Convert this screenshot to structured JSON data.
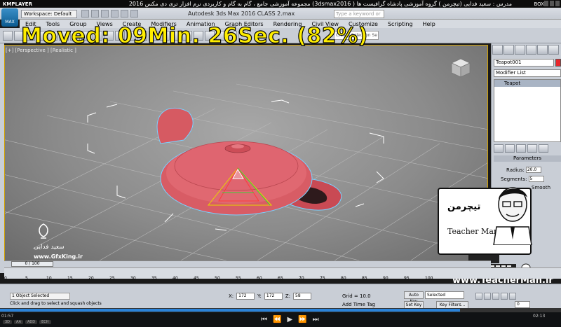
{
  "player": {
    "logo": "KMPLAYER",
    "title": "مجموعه آموزشی جامع ، گام به گام و کاربردی نرم افزار تری دی مکس 2016 (3dsmax2016 ) مدرس : سعید فدایی (تیچرمن ) گروه آموزشی پادشاه گرافیست ها",
    "box_label": "BOX",
    "time_current": "01:57",
    "time_total": "02:13",
    "progress_fraction": 0.82,
    "controls": [
      "⏮",
      "⏪",
      "▶",
      "⏩",
      "⏭"
    ],
    "badges": [
      "3D",
      "AA",
      "ADD",
      "ECH"
    ]
  },
  "overlay": {
    "moved_text": "Moved: 09Min. 26Sec. (82%)"
  },
  "max": {
    "app_button": "MAX",
    "workspace": "Workspace: Default",
    "title": "Autodesk 3ds Max 2016    CLASS 2.max",
    "search_placeholder": "Type a keyword or phrase",
    "menus": [
      "Edit",
      "Tools",
      "Group",
      "Views",
      "Create",
      "Modifiers",
      "Animation",
      "Graph Editors",
      "Rendering",
      "Civil View",
      "Customize",
      "Scripting",
      "Help"
    ],
    "create_selection": "Create Selection Se"
  },
  "viewport": {
    "label": "[+] [Perspective ] [Realistic ]"
  },
  "command_panel": {
    "object_name": "Teapot001",
    "object_color": "#e8272b",
    "modifier_list": "Modifier List",
    "stack_item": "Teapot",
    "params_title": "Parameters",
    "radius_label": "Radius:",
    "radius_value": "20.0",
    "segments_label": "Segments:",
    "segments_value": "5",
    "smooth_label": "Smooth"
  },
  "teacher": {
    "logo_fa": "تیچرمن",
    "name": "Teacher Man",
    "url": "www.TeacherMan.ir"
  },
  "watermark": {
    "name": "سعید فدایی",
    "url": "www.GfxKing.ir"
  },
  "timeline": {
    "slider_label": "0 / 100",
    "ticks": [
      "0",
      "5",
      "10",
      "15",
      "20",
      "25",
      "30",
      "35",
      "40",
      "45",
      "50",
      "55",
      "60",
      "65",
      "70",
      "75",
      "80",
      "85",
      "90",
      "95",
      "100"
    ]
  },
  "status": {
    "selection": "1 Object Selected",
    "prompt": "Click and drag to select and squash objects",
    "x_label": "X:",
    "x_value": "172",
    "y_label": "Y:",
    "y_value": "172",
    "z_label": "Z:",
    "z_value": "58",
    "grid": "Grid = 10.0",
    "add_time_tag": "Add Time Tag",
    "auto_key": "Auto Key",
    "set_key": "Set Key",
    "selected": "Selected",
    "key_filters": "Key Filters...",
    "frame": "0"
  }
}
